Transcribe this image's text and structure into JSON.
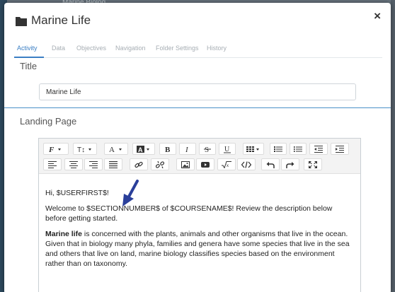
{
  "background": {
    "partial_text": "Marine Biolog"
  },
  "dialog": {
    "title": "Marine Life",
    "close": "×",
    "tabs": [
      {
        "label": "Activity",
        "active": true
      },
      {
        "label": "Data",
        "active": false
      },
      {
        "label": "Objectives",
        "active": false
      },
      {
        "label": "Navigation",
        "active": false
      },
      {
        "label": "Folder Settings",
        "active": false
      },
      {
        "label": "History",
        "active": false
      }
    ],
    "title_field": {
      "label": "Title",
      "value": "Marine Life"
    },
    "landing_page": {
      "label": "Landing Page",
      "toolbar_row1": [
        "font-icon",
        "text-size-icon",
        "font-color-icon",
        "highlight-color-icon",
        "bold-icon",
        "italic-icon",
        "strikethrough-icon",
        "underline-icon",
        "table-icon",
        "bulleted-list-icon",
        "numbered-list-icon",
        "outdent-icon",
        "indent-icon"
      ],
      "toolbar_row2": [
        "align-left-icon",
        "align-center-icon",
        "align-right-icon",
        "justify-icon",
        "link-icon",
        "unlink-icon",
        "image-icon",
        "video-icon",
        "formula-icon",
        "code-view-icon",
        "undo-icon",
        "redo-icon",
        "fullscreen-icon"
      ],
      "content": {
        "greeting": "Hi, $USERFIRST$!",
        "welcome": "Welcome to $SECTIONNUMBER$ of $COURSENAME$! Review the description below before getting started.",
        "bold_lead": "Marine life",
        "body": " is concerned with the plants, animals and other organisms that live in the ocean. Given that in biology many phyla, families and genera have some species that live in the sea and others that live on land, marine biology classifies species based on the environment rather than on taxonomy."
      }
    }
  },
  "colors": {
    "accent": "#3b7fc4",
    "arrow": "#2a3f9a"
  }
}
